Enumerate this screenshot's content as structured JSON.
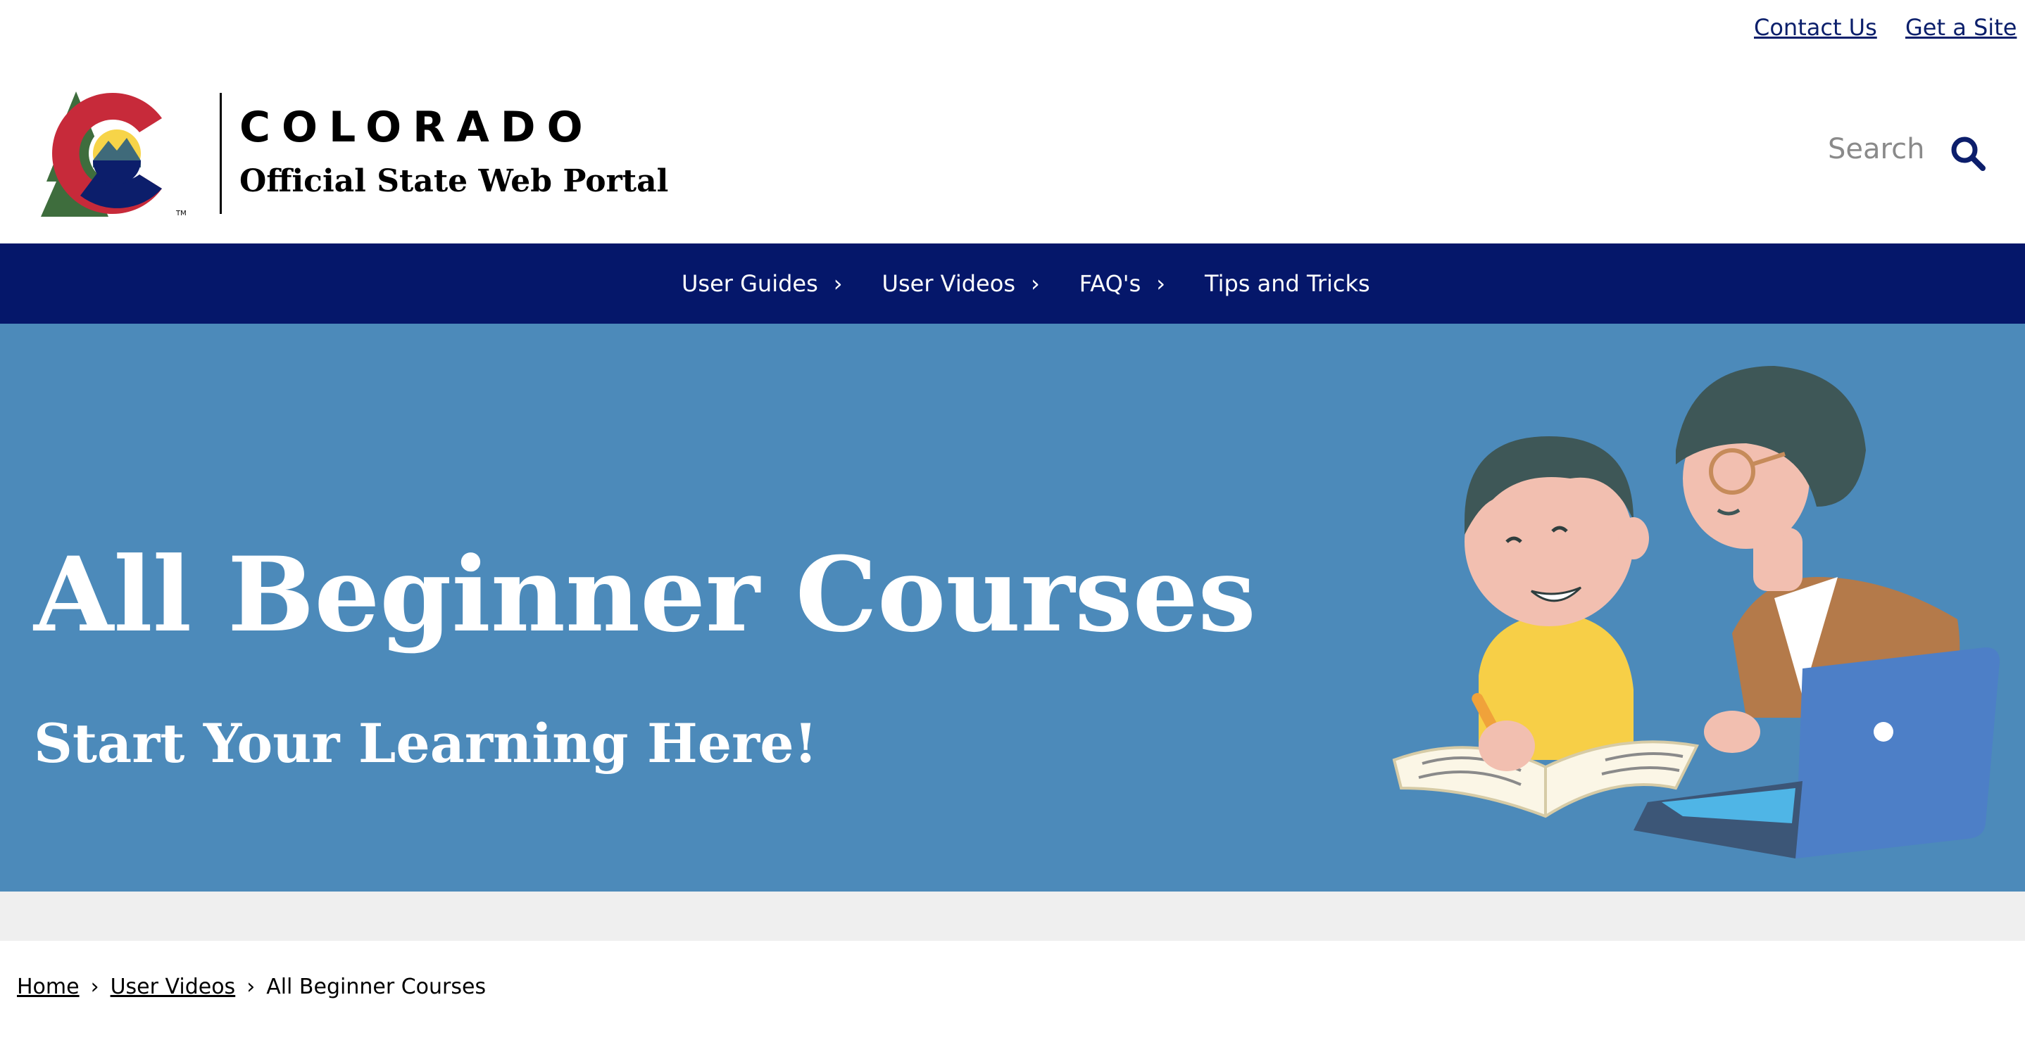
{
  "utility": {
    "contact_label": "Contact Us",
    "get_site_label": "Get a Site"
  },
  "header": {
    "wordmark": "COLORADO",
    "tagline": "Official State Web Portal",
    "logo_icon": "colorado-c-logo-icon",
    "search_placeholder": "Search",
    "search_icon": "search-icon"
  },
  "nav": {
    "items": [
      {
        "label": "User Guides",
        "icon": "chevron-right-icon"
      },
      {
        "label": "User Videos",
        "icon": "chevron-right-icon"
      },
      {
        "label": "FAQ's",
        "icon": "chevron-right-icon"
      },
      {
        "label": "Tips and Tricks"
      }
    ]
  },
  "hero": {
    "title": "All Beginner Courses",
    "subtitle": "Start Your Learning Here!",
    "illustration": "learning-illustration"
  },
  "breadcrumb": {
    "home": "Home",
    "section": "User Videos",
    "current": "All Beginner Courses",
    "separator": "›"
  },
  "colors": {
    "nav_bg": "#05176a",
    "hero_bg": "#4c8aba",
    "link": "#0b1f6b",
    "band": "#efefef"
  }
}
